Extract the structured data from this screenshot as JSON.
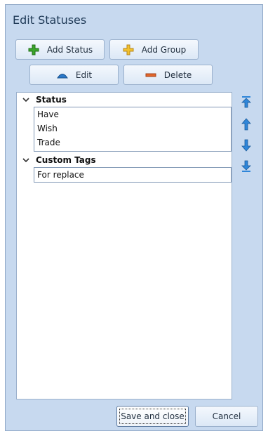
{
  "window": {
    "title": "Edit Statuses"
  },
  "toolbar": {
    "add_status_label": "Add Status",
    "add_group_label": "Add Group",
    "edit_label": "Edit",
    "delete_label": "Delete"
  },
  "groups": [
    {
      "name": "Status",
      "items": [
        "Have",
        "Wish",
        "Trade"
      ]
    },
    {
      "name": "Custom Tags",
      "items": [
        "For replace"
      ]
    }
  ],
  "footer": {
    "save_label": "Save and close",
    "cancel_label": "Cancel"
  },
  "colors": {
    "window_bg": "#c7d9ef",
    "add_icon": "#3aa52b",
    "group_icon": "#f2c12e",
    "delete_icon": "#e2672a",
    "edit_icon": "#2b78c8",
    "arrow_icon": "#2f86d9"
  },
  "icons": {
    "add_status": "green-plus-icon",
    "add_group": "yellow-plus-icon",
    "edit": "blue-triangle-icon",
    "delete": "orange-minus-icon",
    "move_top": "arrow-top-icon",
    "move_up": "arrow-up-icon",
    "move_down": "arrow-down-icon",
    "move_bottom": "arrow-bottom-icon"
  }
}
